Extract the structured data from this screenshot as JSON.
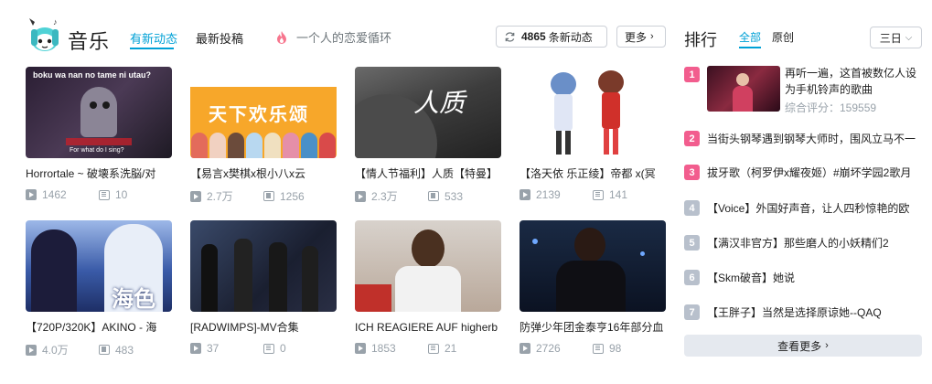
{
  "header": {
    "title": "音乐",
    "tabs": [
      {
        "label": "有新动态"
      },
      {
        "label": "最新投稿"
      }
    ],
    "hot_topic": "一个人的恋爱循环",
    "dynamic_count": "4865",
    "dynamic_suffix": "条新动态",
    "more_label": "更多"
  },
  "videos": [
    {
      "title": "Horrortale ~ 破壊系洗脳/对",
      "plays": "1462",
      "danmaku": "10",
      "thumb_caption": "boku wa nan no tame ni utau?",
      "thumb_sub": "For what do I sing?"
    },
    {
      "title": "【易言x樊棋x根小八x云",
      "plays": "2.7万",
      "danmaku": "1256",
      "thumb_caption": "天下欢乐颂"
    },
    {
      "title": "【情人节福利】人质【特曼】",
      "plays": "2.3万",
      "danmaku": "533",
      "thumb_caption": "人质"
    },
    {
      "title": "【洛天依 乐正绫】帝都 x(冥",
      "plays": "2139",
      "danmaku": "141"
    },
    {
      "title": "【720P/320K】AKINO - 海",
      "plays": "4.0万",
      "danmaku": "483",
      "thumb_caption": "海色"
    },
    {
      "title": "[RADWIMPS]-MV合集",
      "plays": "37",
      "danmaku": "0"
    },
    {
      "title": "ICH REAGIERE AUF higherb",
      "plays": "1853",
      "danmaku": "21"
    },
    {
      "title": "防弹少年团金泰亨16年部分血",
      "plays": "2726",
      "danmaku": "98"
    }
  ],
  "rank": {
    "title": "排行",
    "tabs": [
      {
        "label": "全部"
      },
      {
        "label": "原创"
      }
    ],
    "period": "三日",
    "first": {
      "num": "1",
      "title": "再听一遍，这首被数亿人设为手机铃声的歌曲",
      "score": "综合评分：159559"
    },
    "items": [
      {
        "num": "2",
        "title": "当街头钢琴遇到钢琴大师时，围风立马不一"
      },
      {
        "num": "3",
        "title": "拔牙歌（柯罗伊x耀夜姬）#崩坏学园2歌月"
      },
      {
        "num": "4",
        "title": "【Voice】外国好声音，让人四秒惊艳的欧"
      },
      {
        "num": "5",
        "title": "【满汉非官方】那些磨人的小妖精们2"
      },
      {
        "num": "6",
        "title": "【Skm破音】她说"
      },
      {
        "num": "7",
        "title": "【王胖子】当然是选择原谅她--QAQ"
      }
    ],
    "more_label": "查看更多"
  },
  "colors": {
    "accent": "#00a1d6",
    "pink": "#f25d8e",
    "gray_num": "#b8c0cc"
  }
}
